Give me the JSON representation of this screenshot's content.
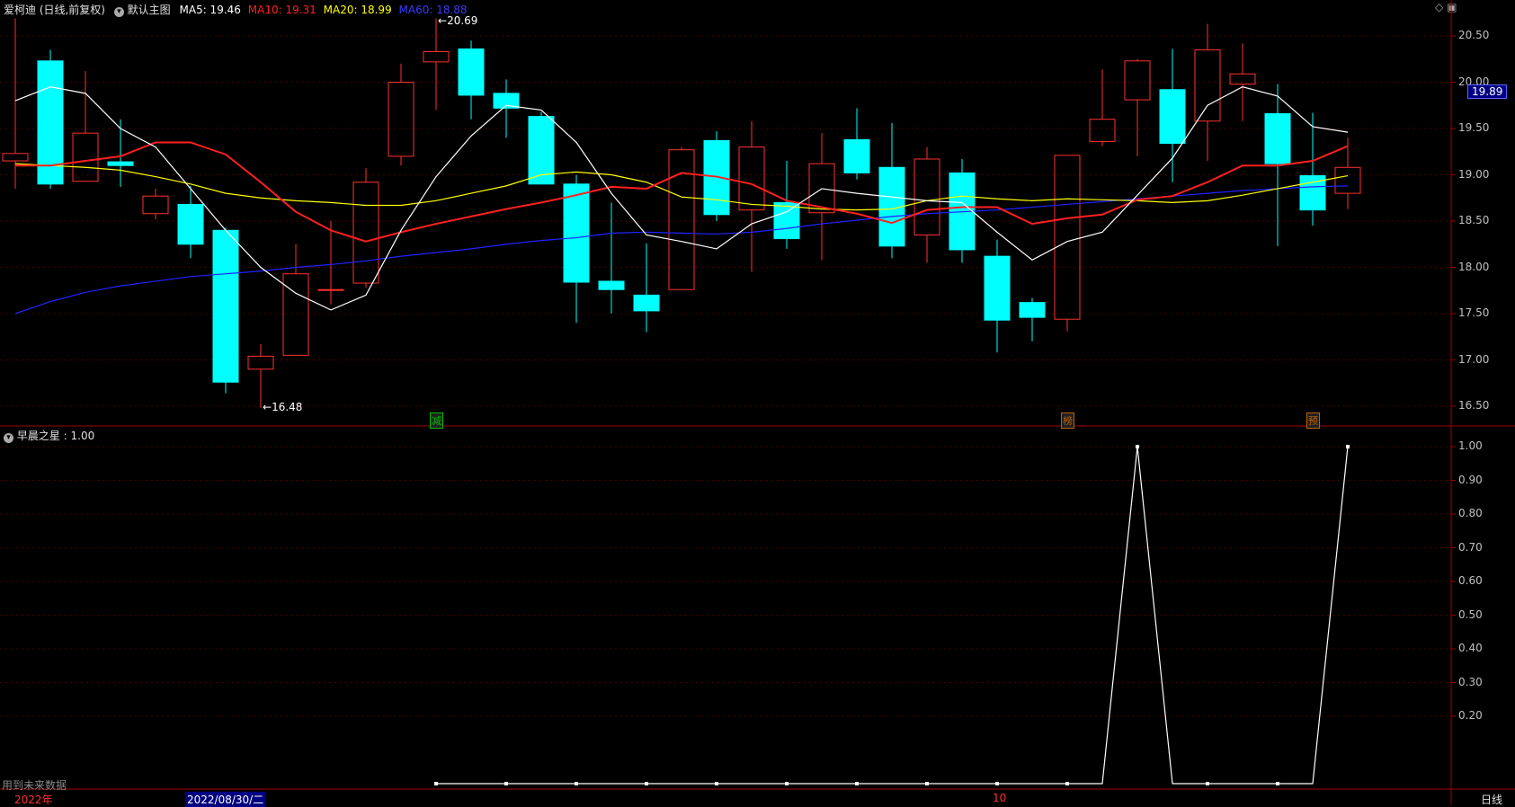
{
  "header": {
    "stock": "爱柯迪 (日线,前复权)",
    "main_chart_label": "默认主图",
    "ma5": {
      "label": "MA5: 19.46",
      "color": "#ffffff"
    },
    "ma10": {
      "label": "MA10: 19.31",
      "color": "#ff2020"
    },
    "ma20": {
      "label": "MA20: 18.99",
      "color": "#ffff00"
    },
    "ma60": {
      "label": "MA60: 18.88",
      "color": "#2222ff"
    }
  },
  "price_axis": {
    "ticks": [
      "20.50",
      "20.00",
      "19.50",
      "19.00",
      "18.50",
      "18.00",
      "17.50",
      "17.00",
      "16.50"
    ],
    "current_price": "19.89"
  },
  "annotations": {
    "high": "20.69",
    "low": "16.48"
  },
  "badges": [
    {
      "text": "减",
      "color": "#00c000"
    },
    {
      "text": "榜",
      "color": "#c06000"
    },
    {
      "text": "预",
      "color": "#c06000"
    }
  ],
  "sub_header": {
    "label": "早晨之星 : 1.00"
  },
  "sub_axis": {
    "ticks": [
      "1.00",
      "0.90",
      "0.80",
      "0.70",
      "0.60",
      "0.50",
      "0.40",
      "0.30",
      "0.20"
    ]
  },
  "footer": {
    "note": "用到未来数据",
    "year": "2022年",
    "date": "2022/08/30/二",
    "month": "10",
    "period": "日线"
  },
  "chart_data": {
    "type": "candlestick",
    "price_ylim": [
      16.3,
      20.7
    ],
    "candles": [
      {
        "open": 19.15,
        "close": 19.23,
        "high": 20.69,
        "low": 18.85
      },
      {
        "open": 20.23,
        "close": 18.9,
        "high": 20.35,
        "low": 18.85
      },
      {
        "open": 18.93,
        "close": 19.45,
        "high": 20.12,
        "low": 18.93
      },
      {
        "open": 19.14,
        "close": 19.1,
        "high": 19.6,
        "low": 18.87
      },
      {
        "open": 18.58,
        "close": 18.77,
        "high": 18.85,
        "low": 18.52
      },
      {
        "open": 18.68,
        "close": 18.25,
        "high": 18.88,
        "low": 18.1
      },
      {
        "open": 18.4,
        "close": 16.76,
        "high": 18.43,
        "low": 16.64
      },
      {
        "open": 16.9,
        "close": 17.04,
        "high": 17.17,
        "low": 16.48
      },
      {
        "open": 17.05,
        "close": 17.93,
        "high": 18.25,
        "low": 17.05
      },
      {
        "open": 17.76,
        "close": 17.76,
        "high": 18.5,
        "low": 17.6
      },
      {
        "open": 17.83,
        "close": 18.92,
        "high": 19.07,
        "low": 17.78
      },
      {
        "open": 19.2,
        "close": 20.0,
        "high": 20.2,
        "low": 19.1
      },
      {
        "open": 20.22,
        "close": 20.33,
        "high": 20.69,
        "low": 19.7
      },
      {
        "open": 20.36,
        "close": 19.86,
        "high": 20.45,
        "low": 19.6
      },
      {
        "open": 19.88,
        "close": 19.72,
        "high": 20.03,
        "low": 19.4
      },
      {
        "open": 19.63,
        "close": 18.9,
        "high": 19.68,
        "low": 18.9
      },
      {
        "open": 18.9,
        "close": 17.84,
        "high": 19.0,
        "low": 17.4
      },
      {
        "open": 17.85,
        "close": 17.76,
        "high": 18.7,
        "low": 17.5
      },
      {
        "open": 17.7,
        "close": 17.53,
        "high": 18.26,
        "low": 17.3
      },
      {
        "open": 17.76,
        "close": 19.27,
        "high": 19.3,
        "low": 17.76
      },
      {
        "open": 19.37,
        "close": 18.57,
        "high": 19.47,
        "low": 18.5
      },
      {
        "open": 18.62,
        "close": 19.3,
        "high": 19.58,
        "low": 17.95
      },
      {
        "open": 18.7,
        "close": 18.31,
        "high": 19.15,
        "low": 18.2
      },
      {
        "open": 18.59,
        "close": 19.12,
        "high": 19.45,
        "low": 18.08
      },
      {
        "open": 19.38,
        "close": 19.02,
        "high": 19.72,
        "low": 18.95
      },
      {
        "open": 19.08,
        "close": 18.23,
        "high": 19.56,
        "low": 18.1
      },
      {
        "open": 18.35,
        "close": 19.17,
        "high": 19.3,
        "low": 18.05
      },
      {
        "open": 19.02,
        "close": 18.19,
        "high": 19.17,
        "low": 18.05
      },
      {
        "open": 18.12,
        "close": 17.43,
        "high": 18.3,
        "low": 17.08
      },
      {
        "open": 17.62,
        "close": 17.46,
        "high": 17.67,
        "low": 17.2
      },
      {
        "open": 17.44,
        "close": 19.21,
        "high": 19.21,
        "low": 17.31
      },
      {
        "open": 19.36,
        "close": 19.6,
        "high": 20.14,
        "low": 19.31
      },
      {
        "open": 19.81,
        "close": 20.23,
        "high": 20.25,
        "low": 19.2
      },
      {
        "open": 19.92,
        "close": 19.34,
        "high": 20.36,
        "low": 18.92
      },
      {
        "open": 19.58,
        "close": 20.35,
        "high": 20.63,
        "low": 19.15
      },
      {
        "open": 19.98,
        "close": 20.09,
        "high": 20.42,
        "low": 19.58
      },
      {
        "open": 19.66,
        "close": 19.12,
        "high": 19.98,
        "low": 18.23
      },
      {
        "open": 18.99,
        "close": 18.62,
        "high": 19.67,
        "low": 18.45
      },
      {
        "open": 18.8,
        "close": 19.08,
        "high": 19.4,
        "low": 18.63
      }
    ],
    "ma5": [
      19.8,
      19.95,
      19.88,
      19.5,
      19.3,
      18.85,
      18.4,
      18.0,
      17.72,
      17.54,
      17.7,
      18.4,
      18.98,
      19.42,
      19.75,
      19.7,
      19.35,
      18.8,
      18.35,
      18.28,
      18.2,
      18.47,
      18.6,
      18.85,
      18.8,
      18.76,
      18.72,
      18.7,
      18.38,
      18.08,
      18.28,
      18.38,
      18.78,
      19.18,
      19.75,
      19.95,
      19.85,
      19.52,
      19.46
    ],
    "ma10": [
      19.1,
      19.1,
      19.15,
      19.2,
      19.35,
      19.35,
      19.22,
      18.92,
      18.6,
      18.4,
      18.28,
      18.38,
      18.47,
      18.55,
      18.63,
      18.7,
      18.78,
      18.87,
      18.85,
      19.02,
      18.98,
      18.9,
      18.72,
      18.65,
      18.58,
      18.48,
      18.62,
      18.65,
      18.65,
      18.47,
      18.53,
      18.57,
      18.73,
      18.77,
      18.92,
      19.1,
      19.1,
      19.15,
      19.31
    ],
    "ma20": [
      19.12,
      19.1,
      19.08,
      19.05,
      18.98,
      18.9,
      18.8,
      18.75,
      18.72,
      18.7,
      18.67,
      18.67,
      18.72,
      18.8,
      18.88,
      19.0,
      19.03,
      19.0,
      18.92,
      18.76,
      18.73,
      18.68,
      18.66,
      18.63,
      18.62,
      18.63,
      18.72,
      18.77,
      18.74,
      18.72,
      18.74,
      18.73,
      18.72,
      18.7,
      18.72,
      18.78,
      18.85,
      18.92,
      18.99
    ],
    "ma60": [
      17.5,
      17.63,
      17.73,
      17.8,
      17.85,
      17.9,
      17.93,
      17.96,
      18.0,
      18.03,
      18.07,
      18.12,
      18.16,
      18.2,
      18.25,
      18.29,
      18.32,
      18.37,
      18.38,
      18.37,
      18.36,
      18.38,
      18.42,
      18.47,
      18.51,
      18.55,
      18.58,
      18.6,
      18.62,
      18.65,
      18.68,
      18.71,
      18.74,
      18.77,
      18.8,
      18.83,
      18.85,
      18.87,
      18.88
    ],
    "indicator": {
      "name": "早晨之星",
      "ylim": [
        0,
        1.05
      ],
      "x_index": [
        12,
        13,
        14,
        15,
        16,
        17,
        18,
        19,
        20,
        21,
        22,
        23,
        24,
        25,
        26,
        27,
        28,
        29,
        30,
        31,
        32,
        33,
        34,
        35,
        36,
        37,
        38
      ],
      "values": [
        0,
        0,
        0,
        0,
        0,
        0,
        0,
        0,
        0,
        0,
        0,
        0,
        0,
        0,
        0,
        0,
        0,
        0,
        0,
        0,
        1,
        0,
        0,
        0,
        0,
        0,
        1
      ]
    }
  }
}
